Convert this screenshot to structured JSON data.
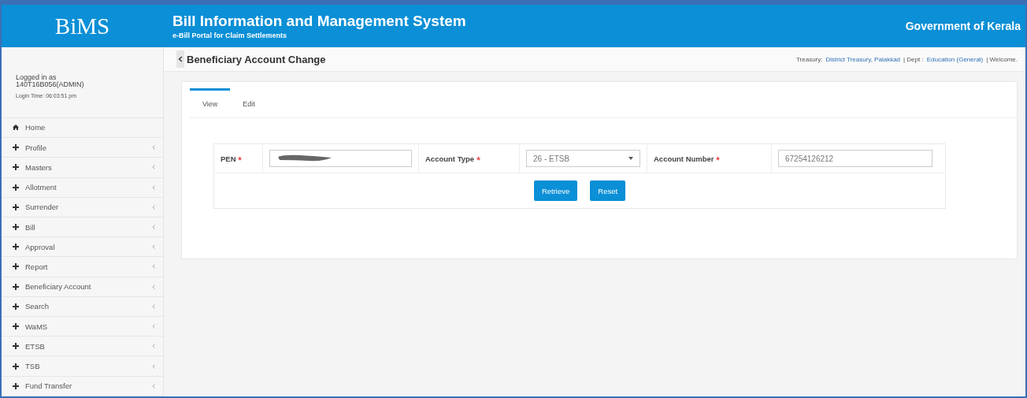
{
  "header": {
    "logo": "BiMS",
    "title": "Bill Information and Management System",
    "subtitle": "e-Bill Portal for Claim Settlements",
    "org": "Government of Kerala"
  },
  "user": {
    "logged_in": "Logged in as\n140T16B056(ADMIN)",
    "login_time": "Login Time: 06:03:51 pm"
  },
  "sidebar": {
    "items": [
      {
        "label": "Home",
        "kind": "home"
      },
      {
        "label": "Profile",
        "kind": "menu"
      },
      {
        "label": "Masters",
        "kind": "menu"
      },
      {
        "label": "Allotment",
        "kind": "menu"
      },
      {
        "label": "Surrender",
        "kind": "menu"
      },
      {
        "label": "Bill",
        "kind": "menu"
      },
      {
        "label": "Approval",
        "kind": "menu"
      },
      {
        "label": "Report",
        "kind": "menu"
      },
      {
        "label": "Beneficiary Account",
        "kind": "menu"
      },
      {
        "label": "Search",
        "kind": "menu"
      },
      {
        "label": "WaMS",
        "kind": "menu"
      },
      {
        "label": "ETSB",
        "kind": "menu"
      },
      {
        "label": "TSB",
        "kind": "menu"
      },
      {
        "label": "Fund Transfer",
        "kind": "menu"
      }
    ]
  },
  "page_title": "Beneficiary Account Change",
  "context": {
    "treasury_label": "Treasury:",
    "treasury": "District Treasury, Palakkad",
    "dept_label": "| Dept :",
    "dept": "Education (General)",
    "welcome": "| Welcome."
  },
  "tabs": [
    {
      "label": "View",
      "selected": true
    },
    {
      "label": "Edit",
      "selected": false
    }
  ],
  "form": {
    "required": true,
    "pen_label": "PEN",
    "account_type_label": "Account Type",
    "account_type": "26 - ETSB",
    "account_number_label": "Account Number",
    "account_number": "67254126212"
  },
  "buttons": [
    "Retrieve",
    "Reset"
  ]
}
